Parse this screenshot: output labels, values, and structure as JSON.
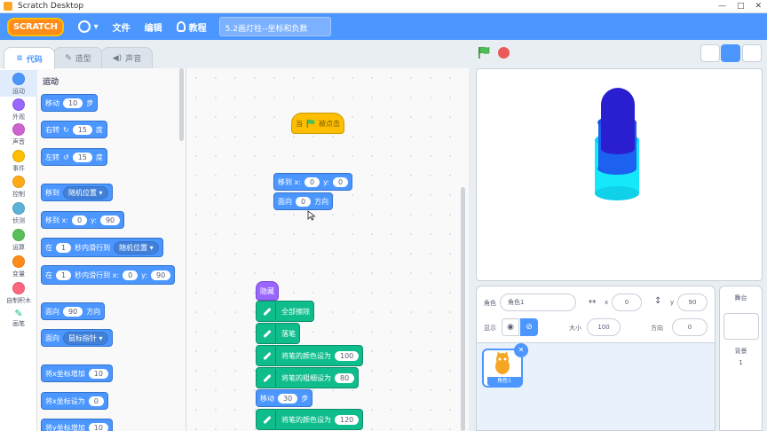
{
  "window": {
    "title": "Scratch Desktop",
    "controls": [
      "—",
      "□",
      "✕"
    ]
  },
  "menubar": {
    "logo": "SCRATCH",
    "file": "文件",
    "edit": "编辑",
    "tutorials": "教程",
    "project_title": "5.2画灯柱--坐标和负数"
  },
  "tabs": {
    "code": "代码",
    "costumes": "造型",
    "sounds": "声音"
  },
  "categories": [
    {
      "label": "运动",
      "color": "#4c97ff"
    },
    {
      "label": "外观",
      "color": "#9966ff"
    },
    {
      "label": "声音",
      "color": "#cf63cf"
    },
    {
      "label": "事件",
      "color": "#ffbf00"
    },
    {
      "label": "控制",
      "color": "#ffab19"
    },
    {
      "label": "侦测",
      "color": "#5cb1d6"
    },
    {
      "label": "运算",
      "color": "#59c059"
    },
    {
      "label": "变量",
      "color": "#ff8c1a"
    },
    {
      "label": "自制积木",
      "color": "#ff6680"
    },
    {
      "label": "画笔",
      "color": "#0fbd8c"
    }
  ],
  "palette": {
    "heading": "运动",
    "move": {
      "a": "移动",
      "v": "10",
      "b": "步"
    },
    "turn_right": {
      "a": "右转",
      "v": "15",
      "b": "度"
    },
    "turn_left": {
      "a": "左转",
      "v": "15",
      "b": "度"
    },
    "goto": {
      "a": "移到",
      "dd": "随机位置 ▾"
    },
    "goto_xy": {
      "a": "移到 x:",
      "x": "0",
      "b": "y:",
      "y": "90"
    },
    "glide": {
      "a": "在",
      "v": "1",
      "b": "秒内滑行到",
      "dd": "随机位置 ▾"
    },
    "glide_xy": {
      "a": "在",
      "v": "1",
      "b": "秒内滑行到 x:",
      "x": "0",
      "c": "y:",
      "y": "90"
    },
    "point": {
      "a": "面向",
      "v": "90",
      "b": "方向"
    },
    "point_towards": {
      "a": "面向",
      "dd": "鼠标指针 ▾"
    },
    "change_x": {
      "a": "将x坐标增加",
      "v": "10"
    },
    "set_x": {
      "a": "将x坐标设为",
      "v": "0"
    },
    "change_y": {
      "a": "将y坐标增加",
      "v": "10"
    }
  },
  "code": {
    "flag_hat": {
      "a": "当",
      "b": "被点击"
    },
    "goto_xy": {
      "a": "移到 x:",
      "x": "0",
      "b": "y:",
      "y": "0"
    },
    "point": {
      "a": "面向",
      "v": "0",
      "b": "方向"
    },
    "hide": {
      "a": "隐藏"
    },
    "clear": {
      "a": "全部擦除"
    },
    "pen_down": {
      "a": "落笔"
    },
    "set_color": {
      "a": "将笔的颜色设为",
      "v": "100"
    },
    "set_size": {
      "a": "将笔的粗细设为",
      "v": "80"
    },
    "move": {
      "a": "移动",
      "v": "30",
      "b": "步"
    },
    "set_color2": {
      "a": "将笔的颜色设为",
      "v": "120"
    }
  },
  "sprite": {
    "label": "角色",
    "name": "角色1",
    "x_label": "x",
    "x": "0",
    "y_label": "y",
    "y": "90",
    "show_label": "显示",
    "size_label": "大小",
    "size": "100",
    "direction_label": "方向",
    "direction": "0",
    "thumb_name": "角色1"
  },
  "stagepane": {
    "title": "舞台",
    "backdrops_label": "背景",
    "backdrops_count": "1"
  },
  "colors": {
    "accent": "#4c97ff",
    "pen": "#0fbd8c",
    "events": "#ffbf00",
    "looks": "#9966ff"
  }
}
